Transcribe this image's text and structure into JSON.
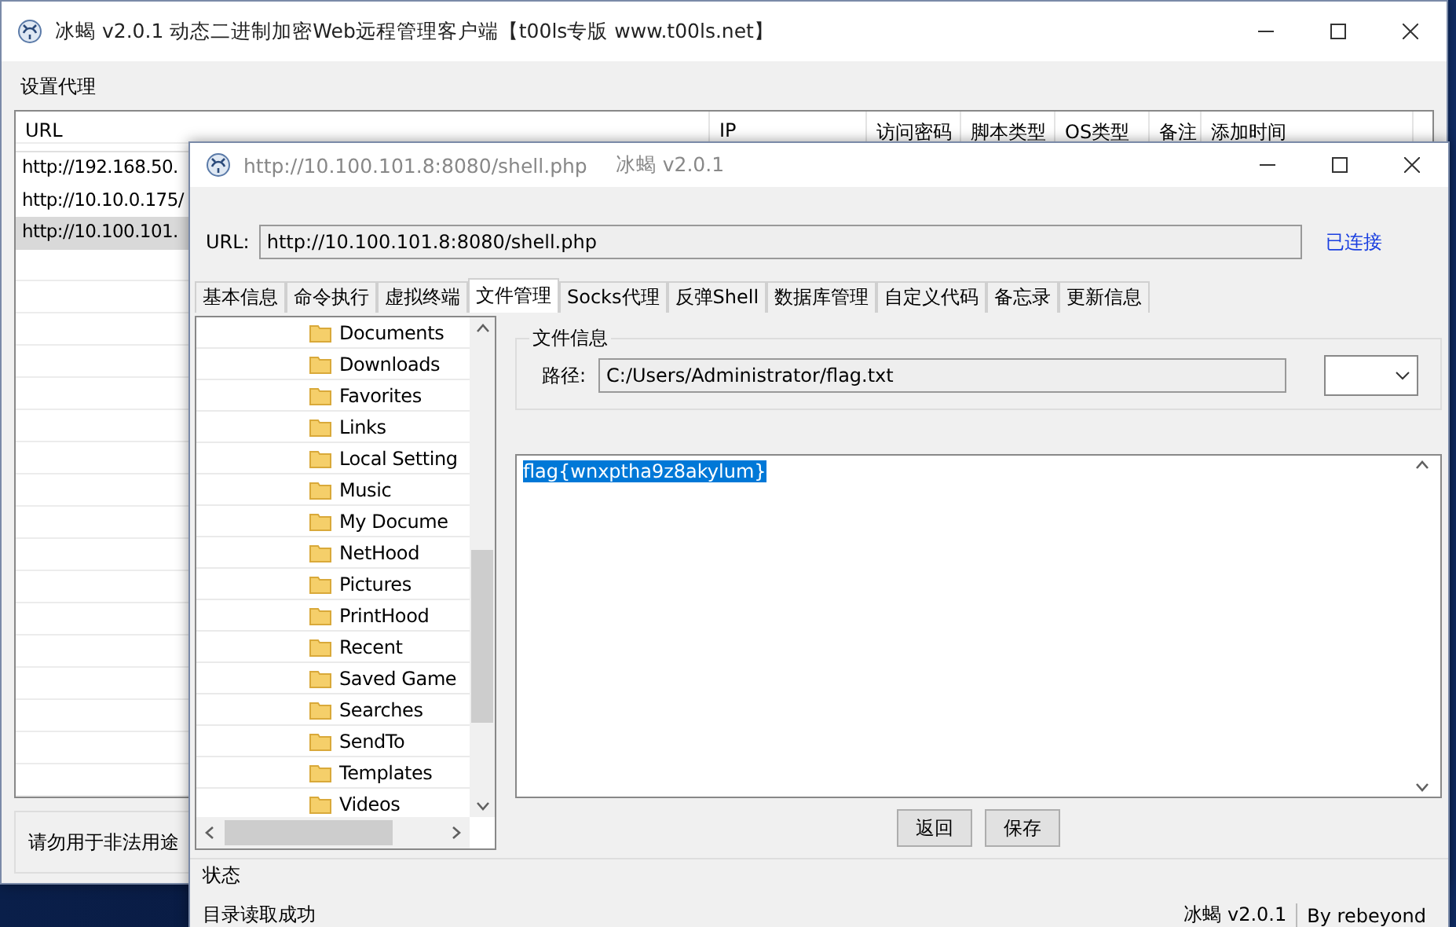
{
  "main_window": {
    "title": "冰蝎 v2.0.1 动态二进制加密Web远程管理客户端【t00ls专版 www.t00ls.net】",
    "menu": [
      "设置代理"
    ],
    "table": {
      "columns": [
        "URL",
        "IP",
        "访问密码",
        "脚本类型",
        "OS类型",
        "备注",
        "添加时间"
      ],
      "rows": [
        {
          "url": "http://192.168.50.",
          "selected": false
        },
        {
          "url": "http://10.10.0.175/",
          "selected": false
        },
        {
          "url": "http://10.100.101.",
          "selected": true
        }
      ]
    },
    "notice": "请勿用于非法用途"
  },
  "shell_window": {
    "title_url": "http://10.100.101.8:8080/shell.php",
    "title_app": "冰蝎 v2.0.1",
    "url_label": "URL:",
    "url_value": "http://10.100.101.8:8080/shell.php",
    "connection_status": "已连接",
    "tabs": [
      {
        "label": "基本信息",
        "selected": false
      },
      {
        "label": "命令执行",
        "selected": false
      },
      {
        "label": "虚拟终端",
        "selected": false
      },
      {
        "label": "文件管理",
        "selected": true
      },
      {
        "label": "Socks代理",
        "selected": false
      },
      {
        "label": "反弹Shell",
        "selected": false
      },
      {
        "label": "数据库管理",
        "selected": false
      },
      {
        "label": "自定义代码",
        "selected": false
      },
      {
        "label": "备忘录",
        "selected": false
      },
      {
        "label": "更新信息",
        "selected": false
      }
    ],
    "file_tree": [
      "Documents",
      "Downloads",
      "Favorites",
      "Links",
      "Local Setting",
      "Music",
      "My Docume",
      "NetHood",
      "Pictures",
      "PrintHood",
      "Recent",
      "Saved Game",
      "Searches",
      "SendTo",
      "Templates",
      "Videos"
    ],
    "file_info": {
      "legend": "文件信息",
      "path_label": "路径:",
      "path_value": "C:/Users/Administrator/flag.txt"
    },
    "editor": {
      "content": "flag{wnxptha9z8akylum}",
      "selected": true
    },
    "buttons": [
      "返回",
      "保存"
    ],
    "status": {
      "legend": "状态",
      "message": "目录读取成功"
    },
    "footer": {
      "version": "冰蝎 v2.0.1",
      "author": "By rebeyond"
    }
  }
}
